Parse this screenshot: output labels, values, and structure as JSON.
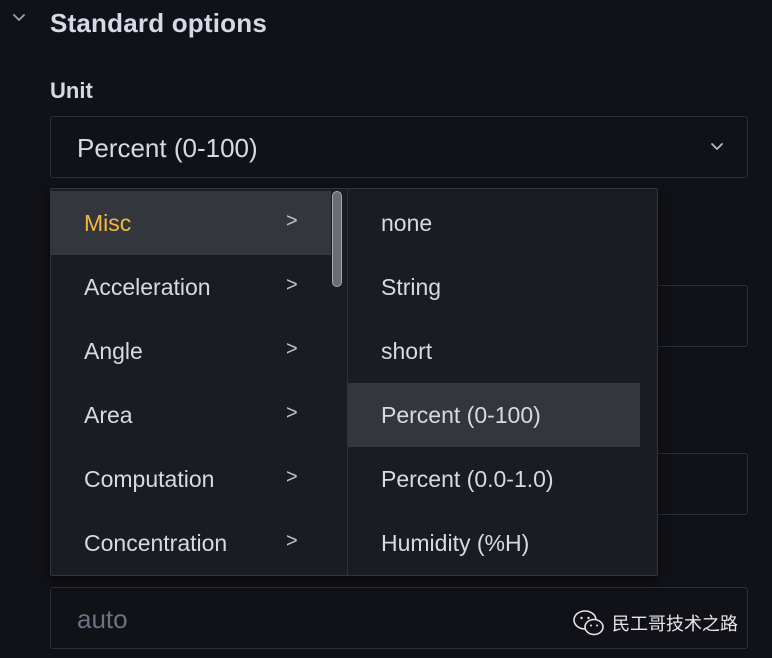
{
  "section": {
    "title": "Standard options"
  },
  "unit": {
    "label": "Unit",
    "selected_value": "Percent (0-100)"
  },
  "background_fields": {
    "auto_placeholder": "auto"
  },
  "cascader": {
    "categories": [
      {
        "label": "Misc",
        "arrow": ">",
        "active": true
      },
      {
        "label": "Acceleration",
        "arrow": ">"
      },
      {
        "label": "Angle",
        "arrow": ">"
      },
      {
        "label": "Area",
        "arrow": ">"
      },
      {
        "label": "Computation",
        "arrow": ">"
      },
      {
        "label": "Concentration",
        "arrow": ">"
      }
    ],
    "options": [
      {
        "label": "none"
      },
      {
        "label": "String"
      },
      {
        "label": "short"
      },
      {
        "label": "Percent (0-100)",
        "active": true
      },
      {
        "label": "Percent (0.0-1.0)"
      },
      {
        "label": "Humidity (%H)"
      }
    ]
  },
  "colors": {
    "background": "#111217",
    "dropdown_bg": "#1b1c22",
    "active_row": "#34363e",
    "highlight_text": "#f5b73b",
    "text": "#d8d9e6"
  },
  "watermark": {
    "text": "民工哥技术之路",
    "icon": "wechat-icon"
  }
}
